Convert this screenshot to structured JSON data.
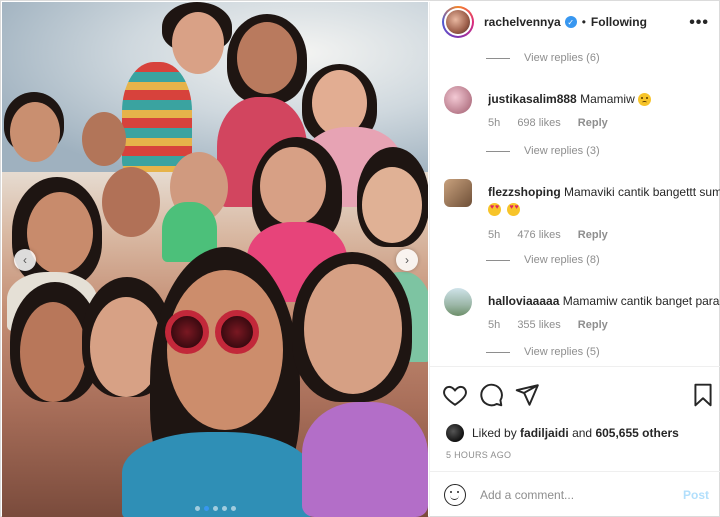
{
  "post": {
    "username": "rachelvennya",
    "separator": "•",
    "follow_state": "Following",
    "more_icon": "more-dots-icon"
  },
  "comments": [
    {
      "view_replies": "View replies (6)"
    },
    {
      "user": "justikasalim888",
      "text": "Mamamiw",
      "emoji": "sad-face",
      "age": "5h",
      "likes": "698 likes",
      "reply": "Reply",
      "view_replies": "View replies (3)"
    },
    {
      "user": "flezzshoping",
      "text": "Mamaviki cantik bangettt sum",
      "emoji": "heart-eyes",
      "age": "5h",
      "likes": "476 likes",
      "reply": "Reply",
      "view_replies": "View replies (8)"
    },
    {
      "user": "halloviaaaaa",
      "text": "Mamamiw cantik banget para",
      "age": "5h",
      "likes": "355 likes",
      "reply": "Reply",
      "view_replies": "View replies (5)"
    }
  ],
  "actions": {
    "like_icon": "heart-icon",
    "comment_icon": "comment-icon",
    "share_icon": "paper-plane-icon",
    "save_icon": "bookmark-icon"
  },
  "likes": {
    "prefix": "Liked by ",
    "user": "fadiljaidi",
    "middle": " and ",
    "others": "605,655 others"
  },
  "timestamp": "5 HOURS AGO",
  "composer": {
    "placeholder": "Add a comment...",
    "post_label": "Post"
  },
  "carousel": {
    "prev": "‹",
    "next": "›",
    "slides": 5,
    "active_slide": 2
  },
  "colors": {
    "accent": "#3897f0",
    "muted": "#8e8e8e",
    "post_disabled": "#b2dffc"
  }
}
